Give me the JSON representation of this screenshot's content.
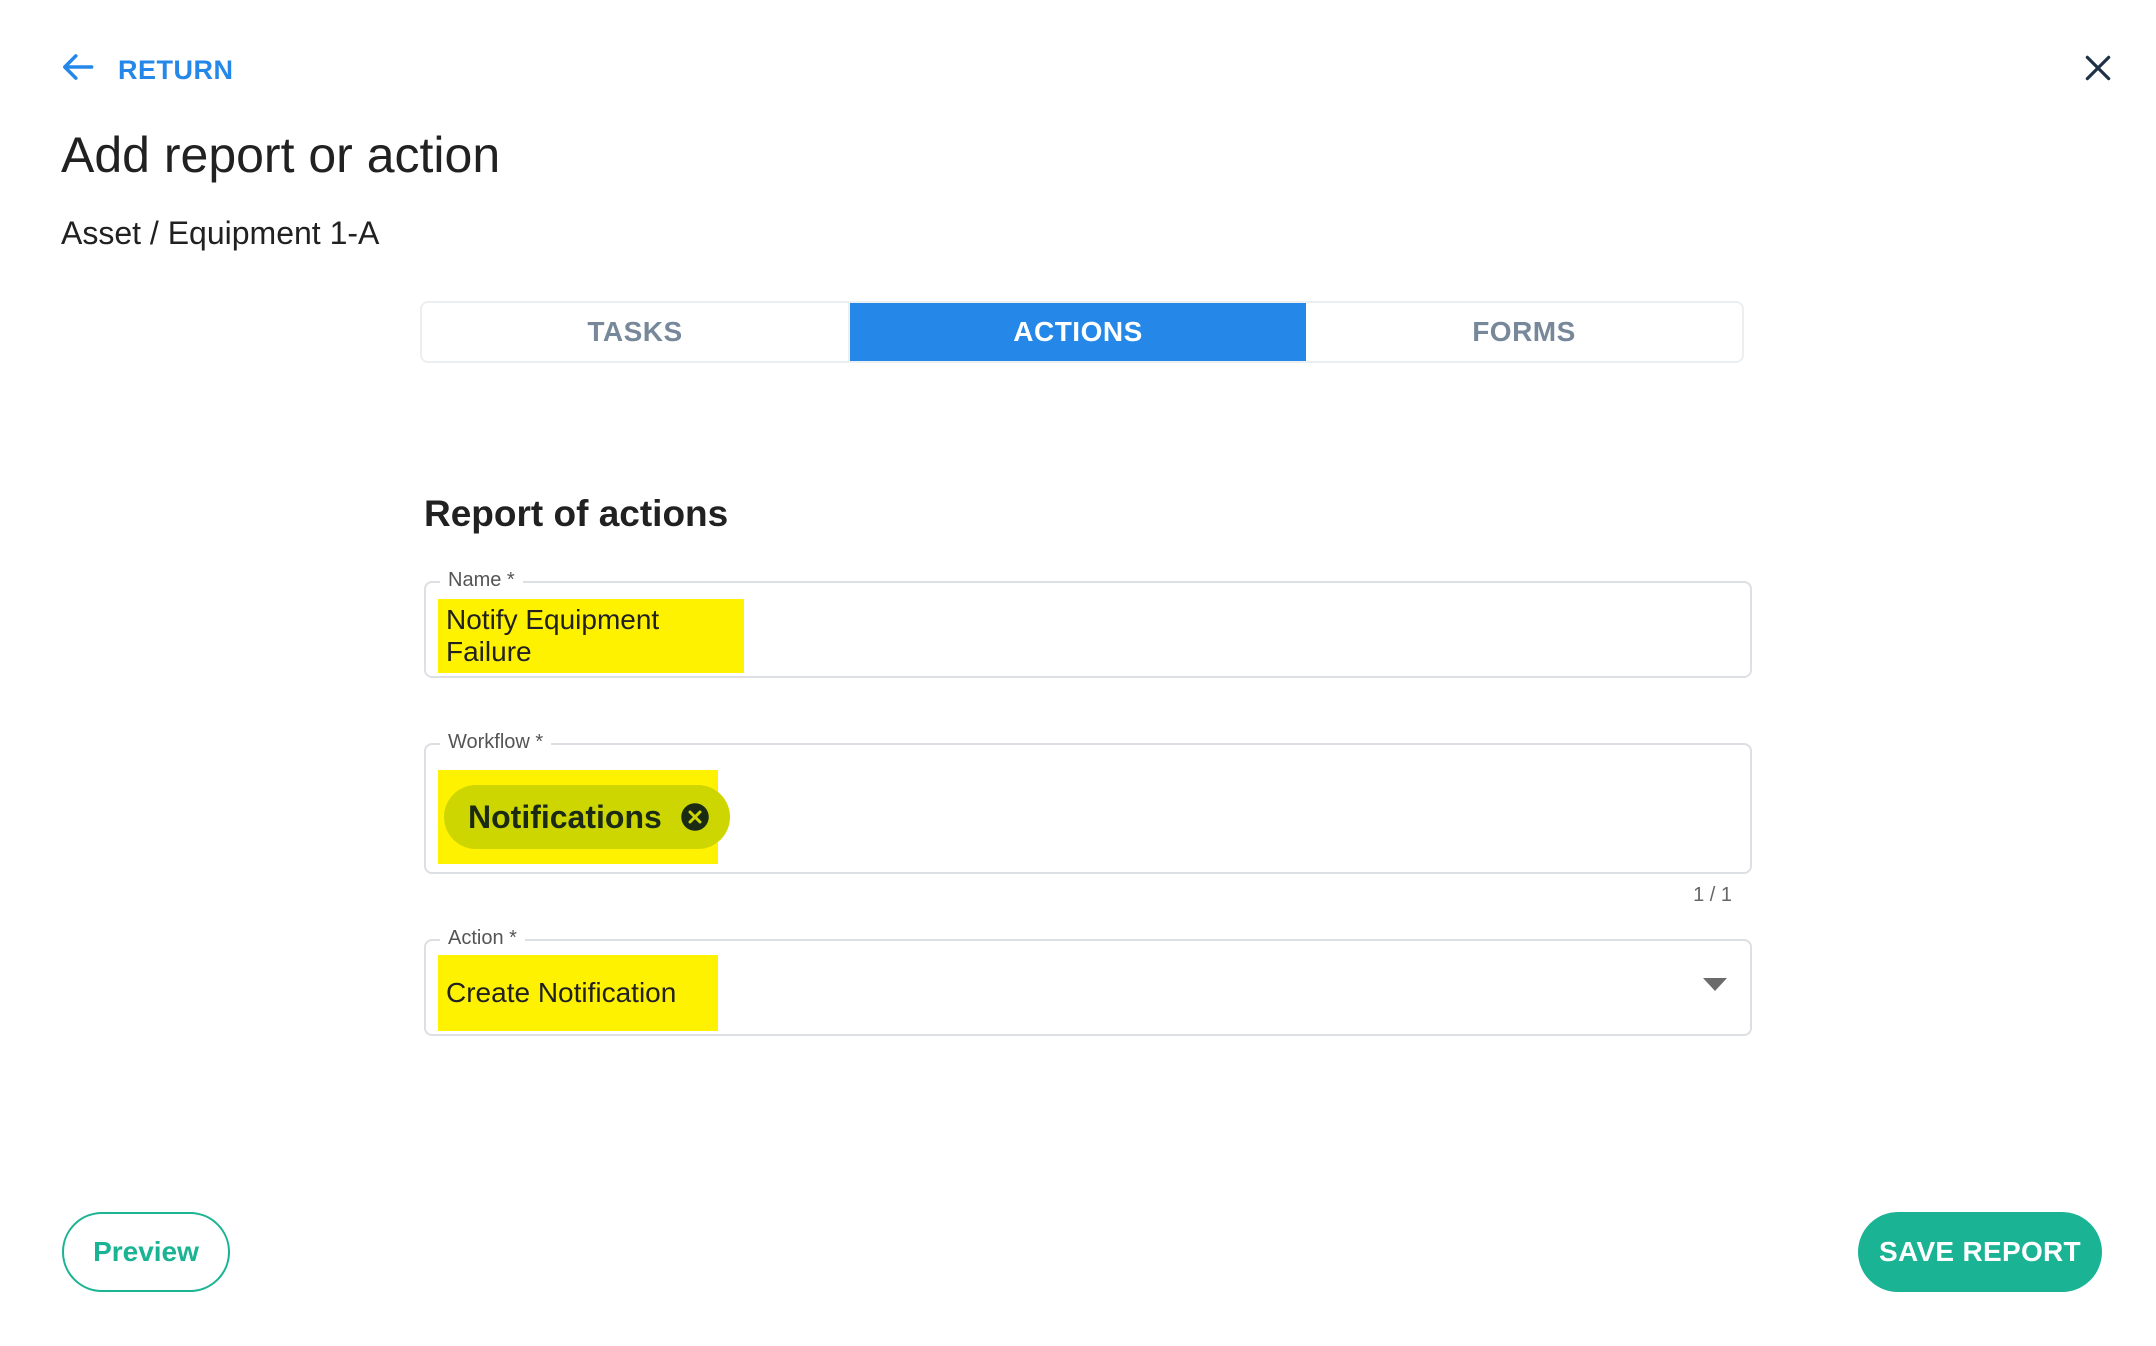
{
  "header": {
    "return_label": "RETURN",
    "return_icon": "arrow-left-icon",
    "close_icon": "close-icon",
    "title": "Add report or action",
    "breadcrumb": "Asset / Equipment 1-A"
  },
  "tabs": [
    {
      "label": "TASKS",
      "active": false
    },
    {
      "label": "ACTIONS",
      "active": true
    },
    {
      "label": "FORMS",
      "active": false
    }
  ],
  "form": {
    "section_title": "Report of actions",
    "name": {
      "label": "Name *",
      "value": "Notify Equipment Failure"
    },
    "workflow": {
      "label": "Workflow *",
      "chips": [
        {
          "label": "Notifications",
          "remove_icon": "close-circle-icon"
        }
      ],
      "counter": "1 / 1"
    },
    "action": {
      "label": "Action *",
      "value": "Create Notification",
      "dropdown_icon": "caret-down-icon"
    }
  },
  "footer": {
    "preview_label": "Preview",
    "save_label": "SAVE REPORT"
  },
  "colors": {
    "primary_blue": "#2588e8",
    "accent_green": "#1ab394",
    "highlight": "#fff200",
    "chip": "#cdd600"
  }
}
